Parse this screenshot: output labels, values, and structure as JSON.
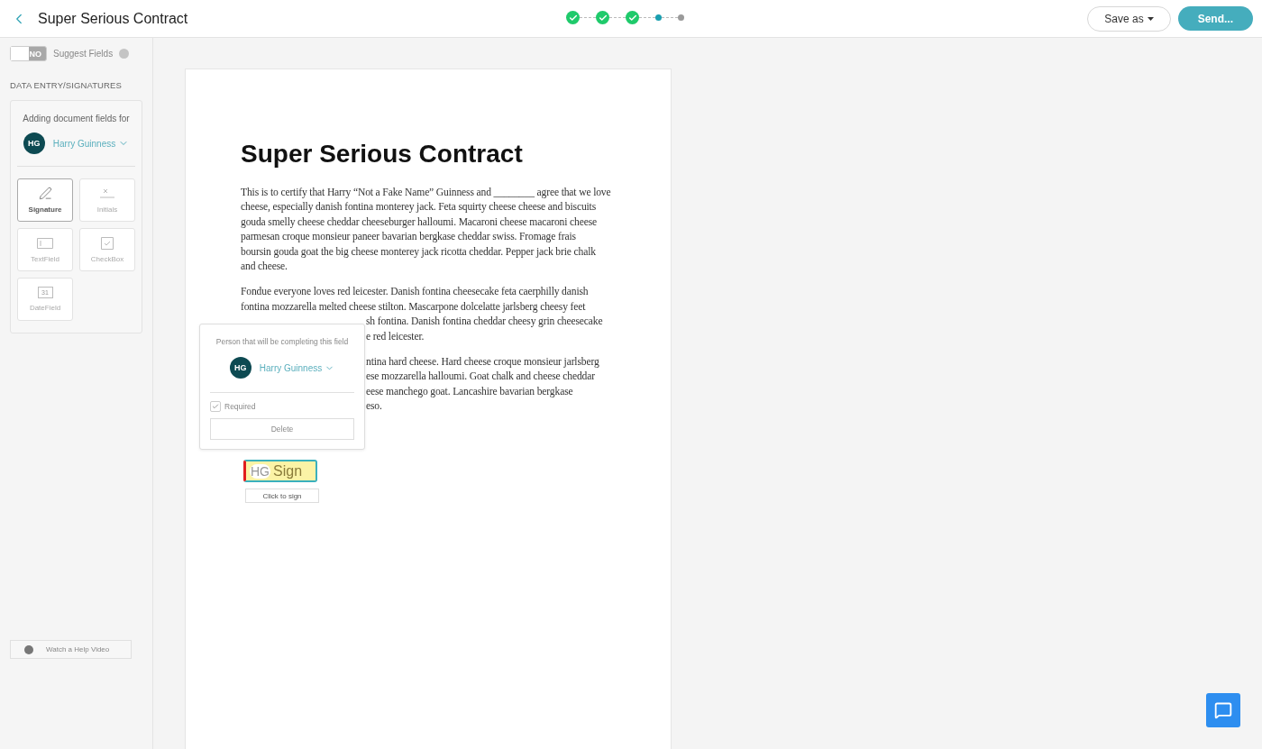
{
  "header": {
    "title": "Super Serious Contract",
    "steps": [
      {
        "kind": "done"
      },
      {
        "kind": "done"
      },
      {
        "kind": "done"
      },
      {
        "kind": "current"
      },
      {
        "kind": "pending"
      }
    ],
    "save_as": "Save as",
    "send": "Send..."
  },
  "sidebar": {
    "toggle": {
      "on": false,
      "label": "NO"
    },
    "suggest_label": "Suggest Fields",
    "section_title": "DATA ENTRY/SIGNATURES",
    "adding_label": "Adding document fields for",
    "signer": {
      "initials": "HG",
      "name": "Harry Guinness"
    },
    "field_types": [
      {
        "kind": "signature",
        "label": "Signature",
        "selected": true
      },
      {
        "kind": "initials",
        "label": "Initials",
        "selected": false
      },
      {
        "kind": "textfield",
        "label": "TextField",
        "selected": false
      },
      {
        "kind": "checkbox",
        "label": "CheckBox",
        "selected": false
      },
      {
        "kind": "datefield",
        "label": "DateField",
        "selected": false,
        "icon_text": "31"
      }
    ],
    "help_button": "Watch a Help Video"
  },
  "document": {
    "heading": "Super Serious Contract",
    "paragraphs": [
      {
        "lines": [
          "This is to certify that Harry “Not a Fake Name” Guinness and ________ agree that we love",
          "cheese, especially danish fontina monterey jack. Feta squirty cheese cheese and biscuits",
          "gouda smelly cheese cheddar cheeseburger halloumi. Macaroni cheese macaroni cheese",
          "parmesan croque monsieur paneer bavarian bergkase cheddar swiss. Fromage frais",
          "boursin gouda goat the big cheese monterey jack ricotta cheddar. Pepper jack brie chalk",
          "and cheese."
        ]
      },
      {
        "lines": [
          "Fondue everyone loves red leicester. Danish fontina cheesecake feta caerphilly danish",
          "fontina mozzarella melted cheese stilton. Mascarpone dolcelatte jarlsberg cheesy feet"
        ],
        "lines_beside_popover": [
          "sh fontina. Danish fontina cheddar cheesy grin cheesecake",
          "e red leicester."
        ]
      },
      {
        "lines_beside_popover": [
          "ntina hard cheese. Hard cheese croque monsieur jarlsberg",
          "ese mozzarella halloumi. Goat chalk and cheese cheddar",
          "eese manchego goat. Lancashire bavarian bergkase",
          "eso."
        ]
      }
    ]
  },
  "popover": {
    "title": "Person that will be completing this field",
    "signer": {
      "initials": "HG",
      "name": "Harry Guinness"
    },
    "required": {
      "label": "Required",
      "checked": true
    },
    "delete": "Delete"
  },
  "sign_field": {
    "initials": "HG",
    "label": "Sign",
    "tooltip": "Click to sign"
  }
}
